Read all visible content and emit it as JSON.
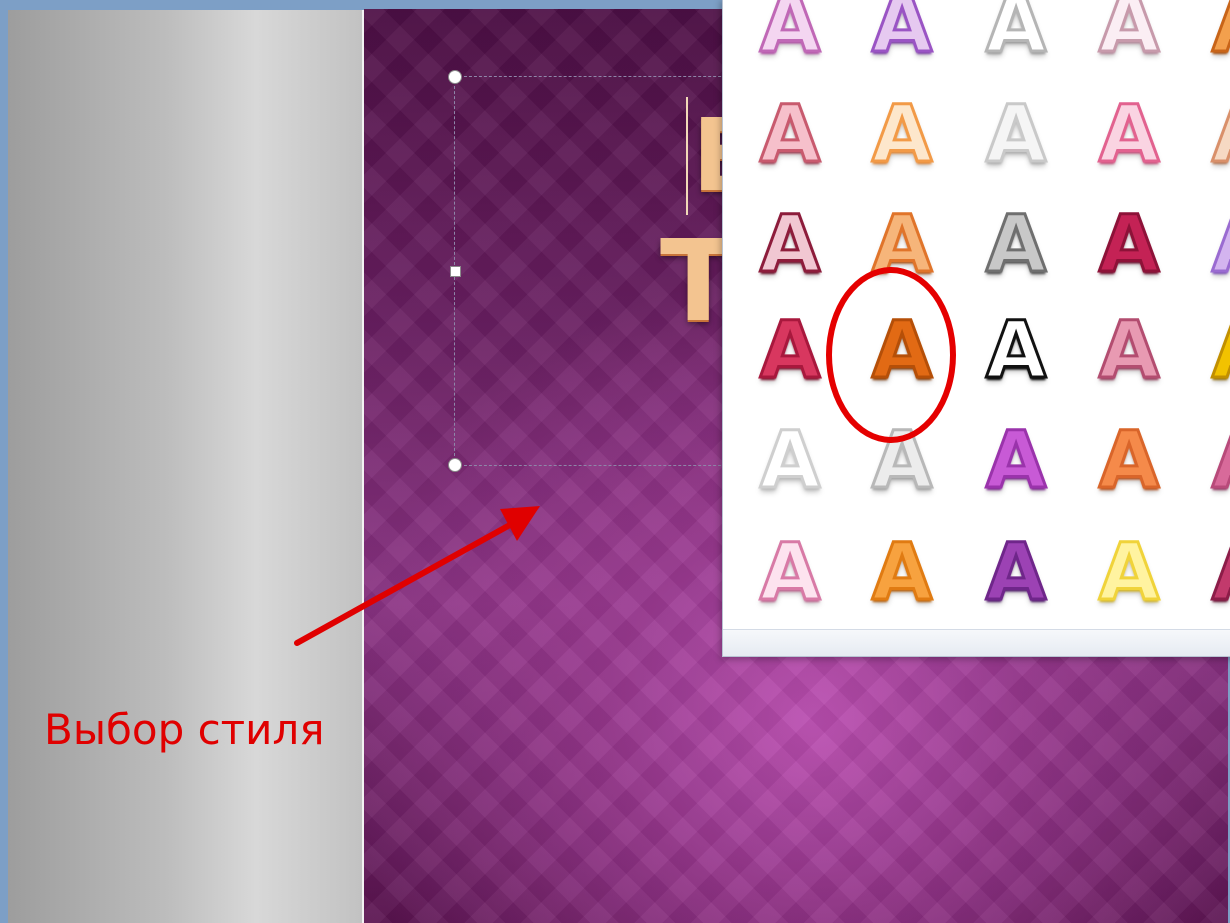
{
  "callout": {
    "label": "Выбор стиля",
    "color": "#e00000"
  },
  "slide": {
    "title_visible_chars": [
      "E",
      "T"
    ],
    "background_accent": "#8a3383"
  },
  "gallery": {
    "selected": {
      "row": 3,
      "col": 1
    },
    "rows": [
      [
        {
          "glyph": "A",
          "fill": "#f4d6f1",
          "stroke": "#c068b6",
          "shadow": "#b04aa4"
        },
        {
          "glyph": "A",
          "fill": "#e6c9f0",
          "stroke": "#9a54c4",
          "shadow": "#7d3aa8"
        },
        {
          "glyph": "A",
          "fill": "#ffffff",
          "stroke": "#b5b5b5",
          "shadow": "#9c9c9c"
        },
        {
          "glyph": "A",
          "fill": "#fbeef4",
          "stroke": "#c79aab",
          "shadow": "#b5879a"
        },
        {
          "glyph": "A",
          "fill": "#f3a04d",
          "stroke": "#c86418",
          "shadow": "#a54e0c"
        }
      ],
      [
        {
          "glyph": "A",
          "fill": "#f6c0cb",
          "stroke": "#c85a6e",
          "shadow": "#a03c52"
        },
        {
          "glyph": "A",
          "fill": "#fde7cc",
          "stroke": "#f29a47",
          "shadow": "#e5852f"
        },
        {
          "glyph": "A",
          "fill": "#f5f5f5",
          "stroke": "#c9c9c9",
          "shadow": "#b0b0b0"
        },
        {
          "glyph": "A",
          "fill": "#fad4e2",
          "stroke": "#e2628f",
          "shadow": "#c94a78"
        },
        {
          "glyph": "A",
          "fill": "#f6d9c3",
          "stroke": "#d9906a",
          "shadow": "#b7744f"
        }
      ],
      [
        {
          "glyph": "A",
          "fill": "#f1c7d2",
          "stroke": "#8d1c3b",
          "shadow": "#6a0f28"
        },
        {
          "glyph": "A",
          "fill": "#f6b57a",
          "stroke": "#e0742a",
          "shadow": "#b55514"
        },
        {
          "glyph": "A",
          "fill": "#c8c8c8",
          "stroke": "#6f6f6f",
          "shadow": "#4e4e4e"
        },
        {
          "glyph": "A",
          "fill": "#c42255",
          "stroke": "#8d1238",
          "shadow": "#6c0a2a"
        },
        {
          "glyph": "A",
          "fill": "#d3b4ef",
          "stroke": "#9a6bd1",
          "shadow": "#7c4db8"
        }
      ],
      [
        {
          "glyph": "A",
          "fill": "#d8375f",
          "stroke": "#a8183d",
          "shadow": "#7f0c2a"
        },
        {
          "glyph": "A",
          "fill": "#e26a14",
          "stroke": "#b54f08",
          "shadow": "#8c3b02"
        },
        {
          "glyph": "A",
          "fill": "#ffffff",
          "stroke": "#111111",
          "shadow": "#000000"
        },
        {
          "glyph": "A",
          "fill": "#e89ab2",
          "stroke": "#b34d70",
          "shadow": "#963a5a"
        },
        {
          "glyph": "A",
          "fill": "#f2c200",
          "stroke": "#c18f00",
          "shadow": "#9a7000"
        }
      ],
      [
        {
          "glyph": "A",
          "fill": "#ffffff",
          "stroke": "#cfcfcf",
          "shadow": "#bdbdbd"
        },
        {
          "glyph": "A",
          "fill": "#ececec",
          "stroke": "#b8b8b8",
          "shadow": "#a3a3a3"
        },
        {
          "glyph": "A",
          "fill": "#c85ad6",
          "stroke": "#9a33ab",
          "shadow": "#7a1f8c"
        },
        {
          "glyph": "A",
          "fill": "#f58a4a",
          "stroke": "#d9652a",
          "shadow": "#b84c15"
        },
        {
          "glyph": "A",
          "fill": "#d86a9a",
          "stroke": "#b84a7a",
          "shadow": "#963462"
        }
      ],
      [
        {
          "glyph": "A",
          "fill": "#fde3ef",
          "stroke": "#d87aa6",
          "shadow": "#c0618e"
        },
        {
          "glyph": "A",
          "fill": "#f7a23f",
          "stroke": "#e07b12",
          "shadow": "#b95e04"
        },
        {
          "glyph": "A",
          "fill": "#9c42b4",
          "stroke": "#6f268a",
          "shadow": "#4f166a"
        },
        {
          "glyph": "A",
          "fill": "#fff3a0",
          "stroke": "#f0d33a",
          "shadow": "#d6b61e"
        },
        {
          "glyph": "A",
          "fill": "#c23a6c",
          "stroke": "#8c1c48",
          "shadow": "#6a0f32"
        }
      ]
    ]
  }
}
